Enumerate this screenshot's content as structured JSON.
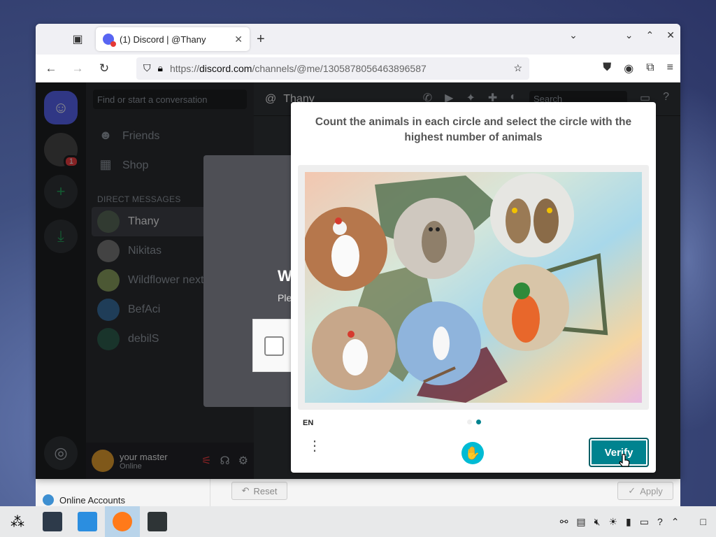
{
  "browser": {
    "tab_title": "(1) Discord | @Thany",
    "url_prefix": "https://",
    "url_domain": "discord.com",
    "url_path": "/channels/@me/1305878056463896587"
  },
  "discord": {
    "search_placeholder": "Find or start a conversation",
    "nav": [
      {
        "label": "Friends"
      },
      {
        "label": "Shop"
      }
    ],
    "dm_header": "DIRECT MESSAGES",
    "dms": [
      {
        "name": "Thany"
      },
      {
        "name": "Nikitas"
      },
      {
        "name": "Wildflower next"
      },
      {
        "name": "BefAci"
      },
      {
        "name": "debilS"
      }
    ],
    "user": {
      "name": "your master",
      "status": "Online"
    },
    "header_name": "Thany",
    "header_search": "Search",
    "server_badge": "1",
    "verify_heading_partial": "W",
    "verify_sub_partial": "Ple"
  },
  "captcha": {
    "prompt": "Count the animals in each circle and select the circle with the highest number of animals",
    "language": "EN",
    "verify_label": "Verify",
    "colors": {
      "accent": "#00838f"
    }
  },
  "settings": {
    "online_accounts": "Online Accounts",
    "reset_label": "Reset",
    "apply_label": "Apply"
  }
}
